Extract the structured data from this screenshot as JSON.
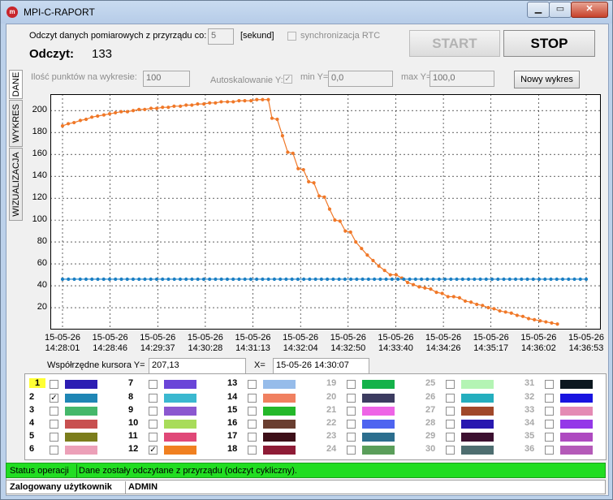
{
  "window": {
    "title": "MPI-C-RAPORT",
    "icon_text": "m"
  },
  "header": {
    "interval_label": "Odczyt danych pomiarowych z przyrządu co:",
    "interval_value": "5",
    "interval_unit": "[sekund]",
    "rtc_label": "synchronizacja RTC",
    "reading_label": "Odczyt:",
    "reading_value": "133",
    "start_label": "START",
    "stop_label": "STOP"
  },
  "tabs": [
    "DANE",
    "WYKRES",
    "WIZUALIZACJA"
  ],
  "controls": {
    "points_label": "Ilość punktów na wykresie:",
    "points_value": "100",
    "autoscale_label": "Autoskalowanie Y:",
    "autoscale_checked": true,
    "miny_label": "min Y=",
    "miny_value": "0,0",
    "maxy_label": "max Y=",
    "maxy_value": "100,0",
    "new_chart_label": "Nowy wykres"
  },
  "cursor": {
    "y_label": "Współrzędne kursora Y=",
    "y_value": "207,13",
    "x_label": "X=",
    "x_value": "15-05-26 14:30:07"
  },
  "chart_data": {
    "type": "line",
    "ylim": [
      0,
      215
    ],
    "y_ticks": [
      20,
      40,
      60,
      80,
      100,
      120,
      140,
      160,
      180,
      200
    ],
    "grid": true,
    "x_tick_labels": [
      [
        "15-05-26",
        "14:28:01"
      ],
      [
        "15-05-26",
        "14:28:46"
      ],
      [
        "15-05-26",
        "14:29:37"
      ],
      [
        "15-05-26",
        "14:30:28"
      ],
      [
        "15-05-26",
        "14:31:13"
      ],
      [
        "15-05-26",
        "14:32:04"
      ],
      [
        "15-05-26",
        "14:32:50"
      ],
      [
        "15-05-26",
        "14:33:40"
      ],
      [
        "15-05-26",
        "14:34:26"
      ],
      [
        "15-05-26",
        "14:35:17"
      ],
      [
        "15-05-26",
        "14:36:02"
      ],
      [
        "15-05-26",
        "14:36:53"
      ]
    ],
    "series": [
      {
        "color": "#f07828",
        "values": [
          186,
          188,
          189,
          191,
          192,
          194,
          195,
          196,
          197,
          198,
          199,
          199,
          200,
          201,
          201,
          202,
          202,
          203,
          203,
          204,
          204,
          205,
          205,
          206,
          206,
          207,
          207,
          208,
          208,
          208,
          209,
          209,
          209,
          210,
          210,
          210,
          193,
          192,
          177,
          162,
          161,
          147,
          146,
          135,
          134,
          122,
          121,
          110,
          100,
          99,
          90,
          89,
          80,
          74,
          68,
          63,
          58,
          54,
          50,
          50,
          47,
          43,
          41,
          39,
          38,
          37,
          34,
          33,
          30,
          30,
          29,
          26,
          25,
          23,
          22,
          20,
          19,
          17,
          16,
          15,
          13,
          12,
          10,
          9,
          8,
          7,
          6,
          5
        ],
        "x_fraction": [
          0.0,
          0.011,
          0.022,
          0.034,
          0.045,
          0.056,
          0.067,
          0.079,
          0.09,
          0.101,
          0.112,
          0.124,
          0.135,
          0.146,
          0.157,
          0.169,
          0.18,
          0.191,
          0.202,
          0.213,
          0.225,
          0.236,
          0.247,
          0.258,
          0.27,
          0.281,
          0.292,
          0.303,
          0.315,
          0.326,
          0.337,
          0.348,
          0.36,
          0.371,
          0.382,
          0.393,
          0.4,
          0.41,
          0.42,
          0.43,
          0.44,
          0.45,
          0.46,
          0.47,
          0.48,
          0.49,
          0.5,
          0.51,
          0.52,
          0.53,
          0.54,
          0.55,
          0.56,
          0.571,
          0.582,
          0.593,
          0.604,
          0.615,
          0.626,
          0.637,
          0.648,
          0.659,
          0.67,
          0.681,
          0.692,
          0.703,
          0.714,
          0.725,
          0.736,
          0.747,
          0.758,
          0.769,
          0.78,
          0.791,
          0.802,
          0.813,
          0.824,
          0.835,
          0.846,
          0.857,
          0.868,
          0.879,
          0.89,
          0.901,
          0.912,
          0.923,
          0.934,
          0.945
        ]
      },
      {
        "color": "#1a7fc4",
        "constant": 46,
        "points": 90
      }
    ]
  },
  "legend": [
    {
      "n": "1",
      "checked": false,
      "color": "#2c1db3",
      "sel": true,
      "dis": false
    },
    {
      "n": "2",
      "checked": true,
      "color": "#1f86b5",
      "sel": false,
      "dis": false
    },
    {
      "n": "3",
      "checked": false,
      "color": "#45b86b",
      "sel": false,
      "dis": false
    },
    {
      "n": "4",
      "checked": false,
      "color": "#c85050",
      "sel": false,
      "dis": false
    },
    {
      "n": "5",
      "checked": false,
      "color": "#7b7d1c",
      "sel": false,
      "dis": false
    },
    {
      "n": "6",
      "checked": false,
      "color": "#eca0b8",
      "sel": false,
      "dis": false
    },
    {
      "n": "7",
      "checked": false,
      "color": "#6a45d8",
      "sel": false,
      "dis": false
    },
    {
      "n": "8",
      "checked": false,
      "color": "#3bb8d0",
      "sel": false,
      "dis": false
    },
    {
      "n": "9",
      "checked": false,
      "color": "#8b58d0",
      "sel": false,
      "dis": false
    },
    {
      "n": "10",
      "checked": false,
      "color": "#a8dc5a",
      "sel": false,
      "dis": false
    },
    {
      "n": "11",
      "checked": false,
      "color": "#e04878",
      "sel": false,
      "dis": false
    },
    {
      "n": "12",
      "checked": true,
      "color": "#f08020",
      "sel": false,
      "dis": false
    },
    {
      "n": "13",
      "checked": false,
      "color": "#96bcea",
      "sel": false,
      "dis": false
    },
    {
      "n": "14",
      "checked": false,
      "color": "#f08060",
      "sel": false,
      "dis": false
    },
    {
      "n": "15",
      "checked": false,
      "color": "#24b82a",
      "sel": false,
      "dis": false
    },
    {
      "n": "16",
      "checked": false,
      "color": "#6a3e30",
      "sel": false,
      "dis": false
    },
    {
      "n": "17",
      "checked": false,
      "color": "#3d0f18",
      "sel": false,
      "dis": false
    },
    {
      "n": "18",
      "checked": false,
      "color": "#8e1c36",
      "sel": false,
      "dis": false
    },
    {
      "n": "19",
      "checked": false,
      "color": "#14b24a",
      "sel": false,
      "dis": true
    },
    {
      "n": "20",
      "checked": false,
      "color": "#3c3c60",
      "sel": false,
      "dis": true
    },
    {
      "n": "21",
      "checked": false,
      "color": "#ee64e6",
      "sel": false,
      "dis": true
    },
    {
      "n": "22",
      "checked": false,
      "color": "#4e64f0",
      "sel": false,
      "dis": true
    },
    {
      "n": "23",
      "checked": false,
      "color": "#2c6e8e",
      "sel": false,
      "dis": true
    },
    {
      "n": "24",
      "checked": false,
      "color": "#5a9e5a",
      "sel": false,
      "dis": true
    },
    {
      "n": "25",
      "checked": false,
      "color": "#b4f4b4",
      "sel": false,
      "dis": true
    },
    {
      "n": "26",
      "checked": false,
      "color": "#24aebe",
      "sel": false,
      "dis": true
    },
    {
      "n": "27",
      "checked": false,
      "color": "#a0482a",
      "sel": false,
      "dis": true
    },
    {
      "n": "28",
      "checked": false,
      "color": "#2818b0",
      "sel": false,
      "dis": true
    },
    {
      "n": "29",
      "checked": false,
      "color": "#3c1030",
      "sel": false,
      "dis": true
    },
    {
      "n": "30",
      "checked": false,
      "color": "#4e6e70",
      "sel": false,
      "dis": true
    },
    {
      "n": "31",
      "checked": false,
      "color": "#0c1820",
      "sel": false,
      "dis": true
    },
    {
      "n": "32",
      "checked": false,
      "color": "#1814e0",
      "sel": false,
      "dis": true
    },
    {
      "n": "33",
      "checked": false,
      "color": "#e48ab4",
      "sel": false,
      "dis": true
    },
    {
      "n": "34",
      "checked": false,
      "color": "#9438e8",
      "sel": false,
      "dis": true
    },
    {
      "n": "35",
      "checked": false,
      "color": "#ae4ac0",
      "sel": false,
      "dis": true
    },
    {
      "n": "36",
      "checked": false,
      "color": "#b45ab8",
      "sel": false,
      "dis": true
    }
  ],
  "status": {
    "label": "Status operacji",
    "message": "Dane zostały odczytane z przyrządu (odczyt cykliczny).",
    "user_label": "Zalogowany użytkownik",
    "user_value": "ADMIN"
  }
}
